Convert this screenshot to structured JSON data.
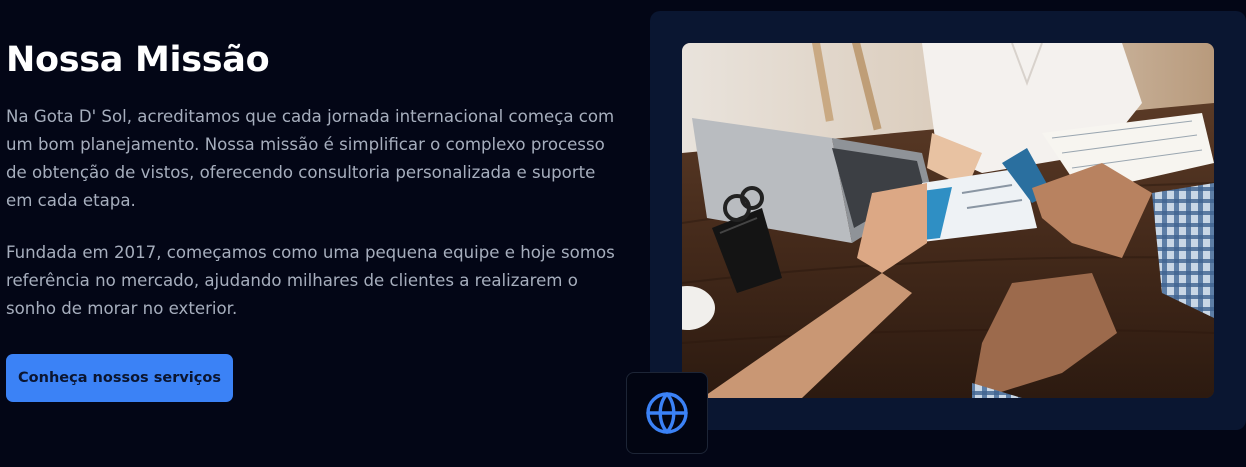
{
  "mission": {
    "title": "Nossa Missão",
    "paragraph_1": "Na Gota D' Sol, acreditamos que cada jornada internacional começa com um bom planejamento. Nossa missão é simplificar o complexo processo de obtenção de vistos, oferecendo consultoria personalizada e suporte em cada etapa.",
    "paragraph_2": "Fundada em 2017, começamos como uma pequena equipe e hoje somos referência no mercado, ajudando milhares de clientes a realizarem o sonho de morar no exterior.",
    "cta_label": "Conheça nossos serviços"
  },
  "image": {
    "subject": "hands exchanging passport and boarding passes over a wooden desk",
    "badge_icon": "globe-icon"
  },
  "colors": {
    "background": "#030616",
    "card": "#0a1631",
    "accent": "#3b82f6",
    "title": "#ffffff",
    "body_text": "#a6aebd"
  }
}
